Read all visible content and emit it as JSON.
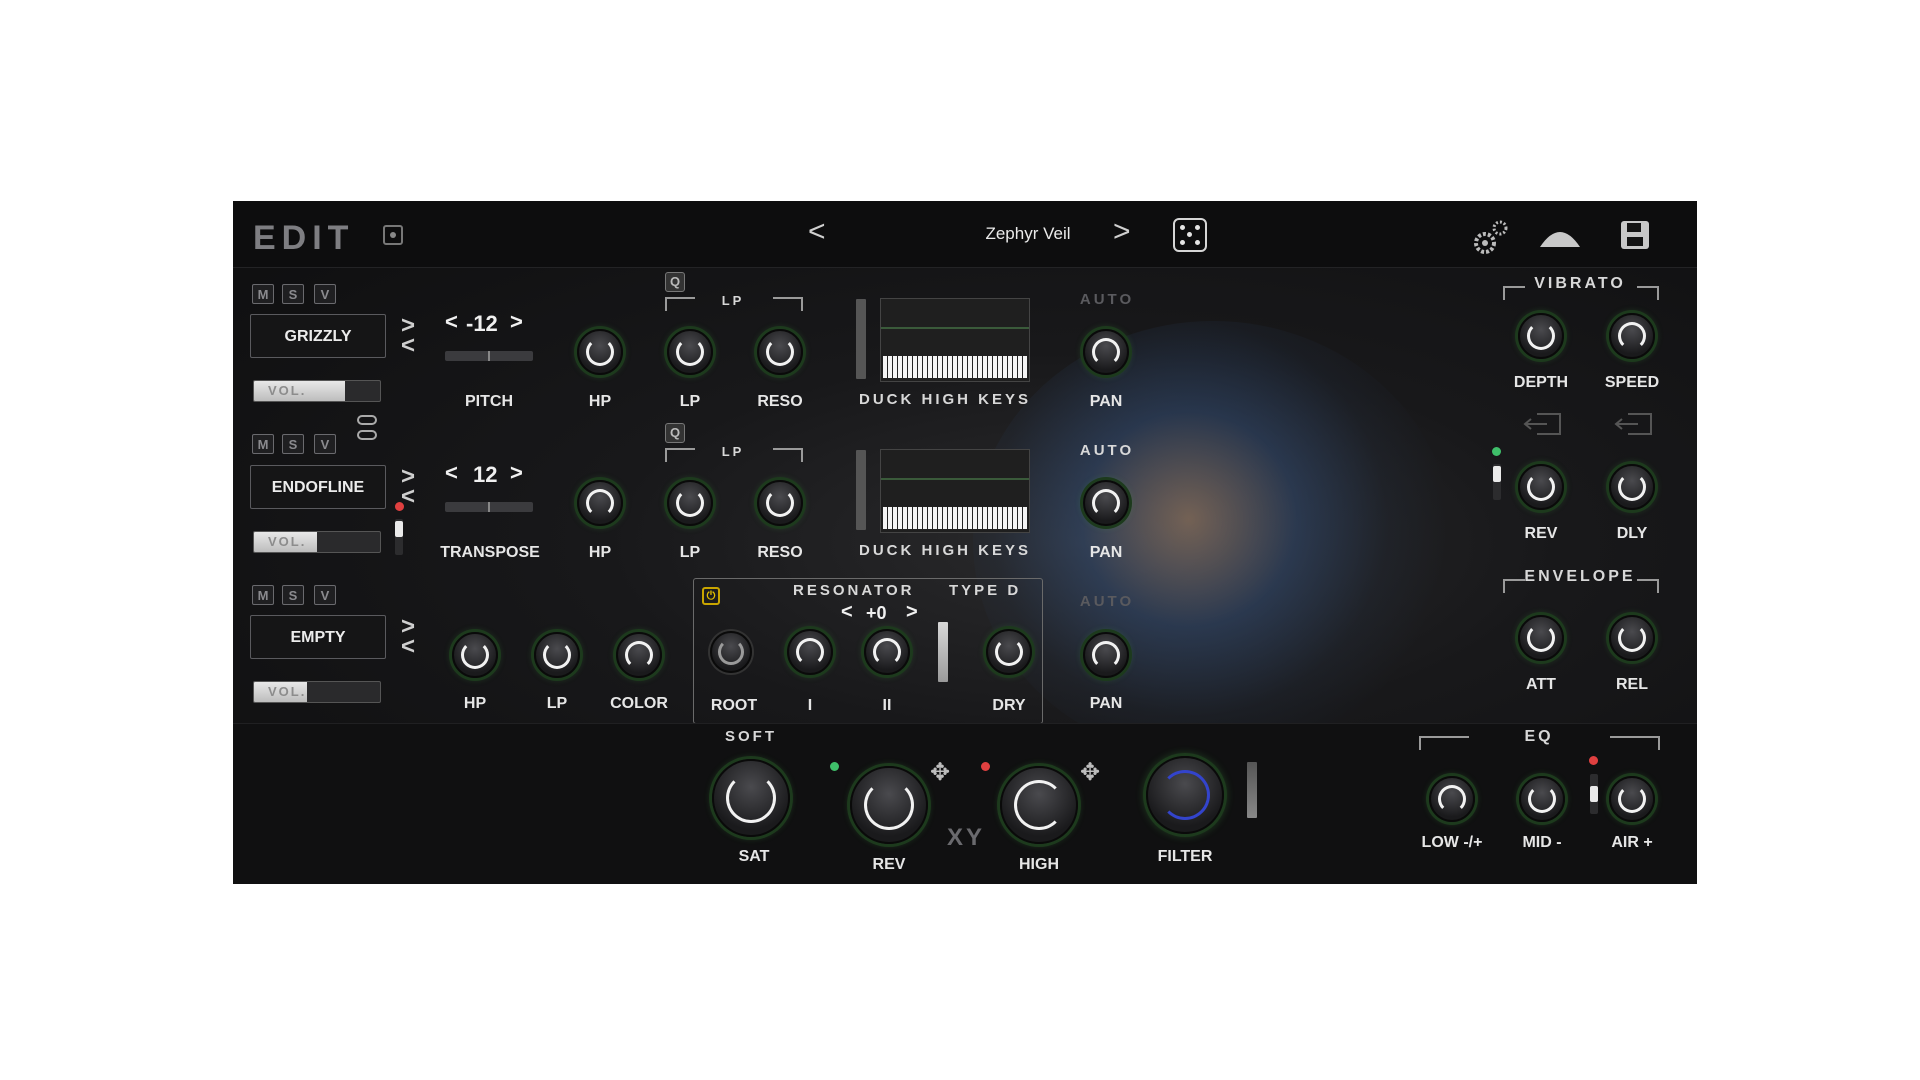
{
  "header": {
    "title": "EDIT",
    "preset_name": "Zephyr Veil",
    "prev": "<",
    "next": ">",
    "icons": [
      "record-icon",
      "dice-icon",
      "gears-icon",
      "mountain-icon",
      "save-icon"
    ]
  },
  "layers": [
    {
      "m": "M",
      "s": "S",
      "v": "V",
      "name": "GRIZZLY",
      "vol_label": "VOL.",
      "vol_level": 0.72,
      "chev_up": ">",
      "chev_down": "<"
    },
    {
      "m": "M",
      "s": "S",
      "v": "V",
      "name": "ENDOFLINE",
      "vol_label": "VOL.",
      "vol_level": 0.5,
      "chev_up": ">",
      "chev_down": "<"
    },
    {
      "m": "M",
      "s": "S",
      "v": "V",
      "name": "EMPTY",
      "vol_label": "VOL.",
      "vol_level": 0.42,
      "chev_up": ">",
      "chev_down": "<"
    }
  ],
  "row1": {
    "stepper_left": "<",
    "stepper_value": "-12",
    "stepper_right": ">",
    "stepper_label": "PITCH",
    "hp": "HP",
    "lp_section": "LP",
    "lp": "LP",
    "reso": "RESO",
    "duck": "DUCK HIGH KEYS",
    "auto": "AUTO",
    "pan": "PAN"
  },
  "row2": {
    "stepper_left": "<",
    "stepper_value": "12",
    "stepper_right": ">",
    "stepper_label": "TRANSPOSE",
    "hp": "HP",
    "lp_section": "LP",
    "lp": "LP",
    "reso": "RESO",
    "duck": "DUCK HIGH KEYS",
    "auto": "AUTO",
    "pan": "PAN"
  },
  "row3": {
    "hp": "HP",
    "lp": "LP",
    "color": "COLOR",
    "auto": "AUTO",
    "pan": "PAN"
  },
  "resonator": {
    "title": "RESONATOR",
    "type": "TYPE D",
    "step_left": "<",
    "step_value": "+0",
    "step_right": ">",
    "root": "ROOT",
    "i": "I",
    "ii": "II",
    "dry": "DRY"
  },
  "vibrato": {
    "title": "VIBRATO",
    "depth": "DEPTH",
    "speed": "SPEED",
    "rev": "REV",
    "dly": "DLY"
  },
  "envelope": {
    "title": "ENVELOPE",
    "att": "ATT",
    "rel": "REL"
  },
  "bottom": {
    "soft": "SOFT",
    "sat": "SAT",
    "rev": "REV",
    "xy": "XY",
    "high": "HIGH",
    "filter": "FILTER"
  },
  "eq": {
    "title": "EQ",
    "low": "LOW -/+",
    "mid": "MID -",
    "air": "AIR +"
  },
  "colors": {
    "accent_green": "#3fbf6a",
    "accent_red": "#e04040",
    "power_yellow": "#e0bd00",
    "filter_blue": "#3344cc"
  }
}
